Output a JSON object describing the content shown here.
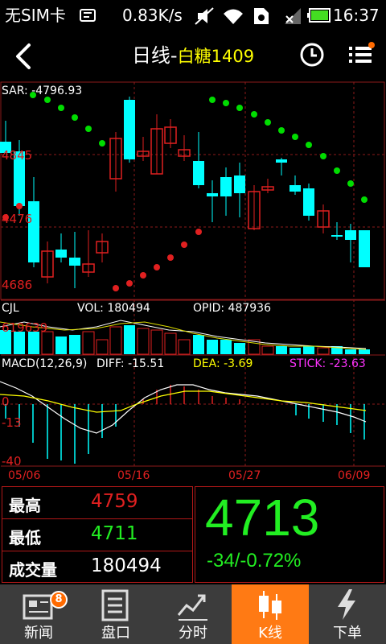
{
  "status_bar": {
    "carrier": "无SIM卡",
    "speed": "0.83K/s",
    "time": "16:37"
  },
  "title_bar": {
    "title": "日线-",
    "symbol": "白糖1409"
  },
  "colors": {
    "up": "#e02020",
    "down": "#00ffff",
    "sar": "#00dd00",
    "background": "#000000",
    "grid": "#8b1a1a",
    "accent_nav": "#ff7a14",
    "price_down": "#22ee22"
  },
  "chart": {
    "sar_label": "SAR: -4796.93",
    "price_axis": [
      "4845",
      "4476",
      "4686"
    ],
    "volume_header": {
      "name": "CJL",
      "vol": "VOL: 180494",
      "opid": "OPID: 487936"
    },
    "volume_axis_top": "619639",
    "macd_header": {
      "name": "MACD(12,26,9)",
      "diff": "DIFF: -15.51",
      "dea": "DEA: -3.69",
      "stick": "STICK: -23.63"
    },
    "macd_axis": [
      "0",
      "-13",
      "-40"
    ],
    "dates": [
      "05/06",
      "05/16",
      "05/27",
      "06/09"
    ]
  },
  "info": {
    "high_label": "最高",
    "high_value": "4759",
    "low_label": "最低",
    "low_value": "4711",
    "volume_label": "成交量",
    "volume_value": "180494",
    "last_price": "4713",
    "change": "-34/-0.72%"
  },
  "nav": {
    "items": [
      {
        "label": "新闻",
        "badge": "8"
      },
      {
        "label": "盘口"
      },
      {
        "label": "分时"
      },
      {
        "label": "K线"
      },
      {
        "label": "下单"
      }
    ]
  }
}
